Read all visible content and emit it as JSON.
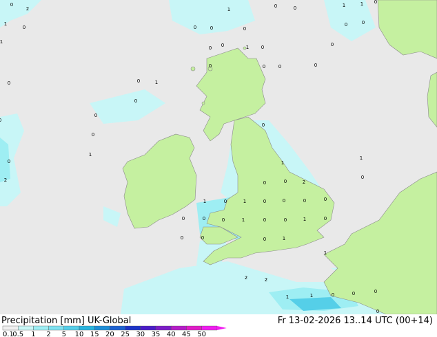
{
  "title": "Precipitation [mm]",
  "model": "UK-Global",
  "valid_time": "Fr 13-02-2026 13..14 UTC (00+14)",
  "legend": {
    "ticks": [
      "0.1",
      "0.5",
      "1",
      "2",
      "5",
      "10",
      "15",
      "20",
      "25",
      "30",
      "35",
      "40",
      "45",
      "50"
    ],
    "colors": [
      "#f0f0f0",
      "#c9f7f7",
      "#9eeef4",
      "#7fe2f1",
      "#57cfe9",
      "#2ab5df",
      "#1e8fd8",
      "#1c62d2",
      "#1c34c8",
      "#4a1cc8",
      "#7c1cc8",
      "#b51cc8",
      "#e01cc8",
      "#f01cf0"
    ]
  },
  "colors": {
    "sea": "#e9e9e9",
    "land": "#c5f0a0",
    "light_precip": "#c8f6f7",
    "medium_precip": "#9eeef3",
    "heavy_precip": "#55cfe8"
  },
  "values": [
    "2",
    "0",
    "1",
    "0",
    "1",
    "1",
    "0",
    "0",
    "0",
    "0",
    "0",
    "1",
    "1",
    "0",
    "0",
    "0",
    "0",
    "1",
    "0",
    "0",
    "0",
    "0",
    "0",
    "0",
    "0",
    "0",
    "0",
    "1",
    "0",
    "0",
    "0",
    "1",
    "0",
    "0",
    "2",
    "0",
    "1",
    "1",
    "0",
    "0",
    "0",
    "2",
    "0",
    "1",
    "0",
    "1",
    "0",
    "0",
    "0",
    "0",
    "1",
    "0",
    "0",
    "1",
    "0",
    "0",
    "0",
    "0",
    "0",
    "0",
    "1",
    "1",
    "2",
    "2",
    "1",
    "1",
    "0",
    "0",
    "0",
    "0"
  ]
}
